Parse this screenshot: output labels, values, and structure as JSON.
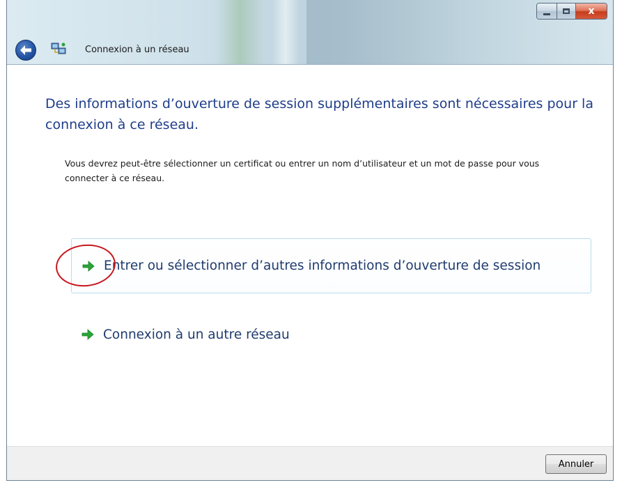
{
  "window": {
    "nav_title": "Connexion à un réseau",
    "controls": {
      "minimize": "minimize",
      "maximize": "maximize",
      "close": "x"
    }
  },
  "main": {
    "heading": "Des informations d’ouverture de session supplémentaires sont nécessaires pour la connexion à ce réseau.",
    "description": "Vous devrez peut-être sélectionner un certificat ou entrer un nom d’utilisateur et un mot de passe pour vous connecter à ce réseau.",
    "options": [
      {
        "label": "Entrer ou sélectionner d’autres informations d’ouverture de session",
        "icon": "green-arrow-icon"
      },
      {
        "label": "Connexion à un autre réseau",
        "icon": "green-arrow-icon"
      }
    ]
  },
  "footer": {
    "cancel_label": "Annuler"
  },
  "colors": {
    "heading": "#1e3d8a",
    "option_text": "#1f3b6e",
    "arrow": "#2aa43a",
    "annotation": "#c8161d"
  }
}
